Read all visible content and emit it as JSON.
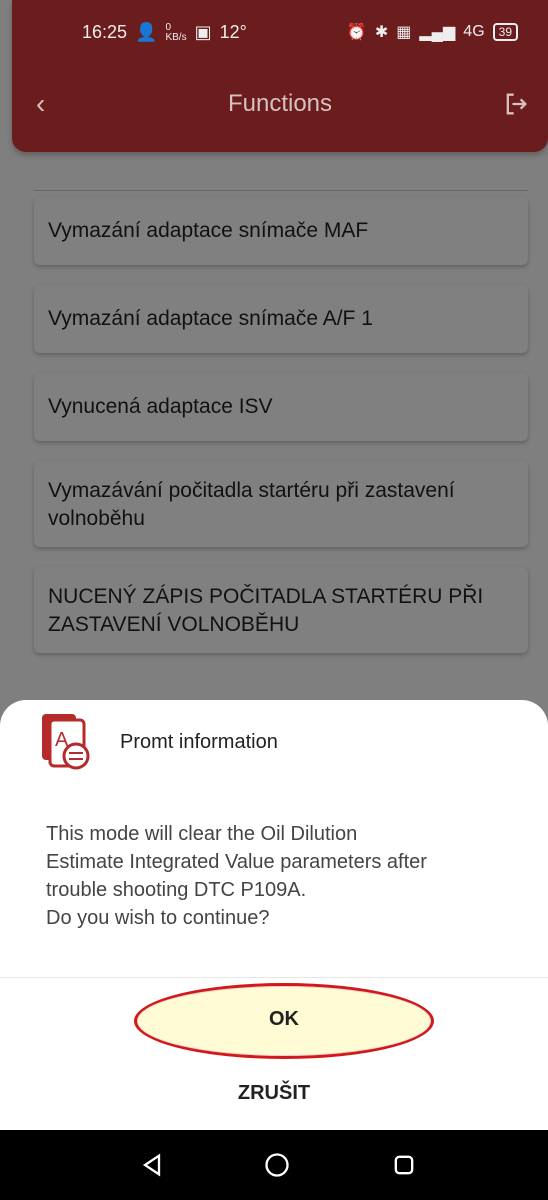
{
  "status": {
    "time": "16:25",
    "speed": "0",
    "speed_unit": "KB/s",
    "temp": "12°",
    "battery": "39"
  },
  "header": {
    "title": "Functions"
  },
  "list": [
    {
      "label": "Vymazání adaptace snímače MAF"
    },
    {
      "label": "Vymazání adaptace snímače A/F 1"
    },
    {
      "label": "Vynucená adaptace ISV"
    },
    {
      "label": "Vymazávání počitadla startéru při zastavení volnoběhu"
    },
    {
      "label": "NUCENÝ ZÁPIS POČITADLA STARTÉRU PŘI ZASTAVENÍ VOLNOBĚHU"
    }
  ],
  "dialog": {
    "title": "Promt information",
    "message": "This mode will clear the Oil Dilution\nEstimate Integrated Value  parameters after\ntrouble shooting  DTC P109A.\nDo you wish to continue?",
    "ok": "OK",
    "cancel": "ZRUŠIT"
  },
  "colors": {
    "header": "#6b1c1d",
    "accent_red": "#d21818",
    "ok_bg": "#fffbd5"
  }
}
